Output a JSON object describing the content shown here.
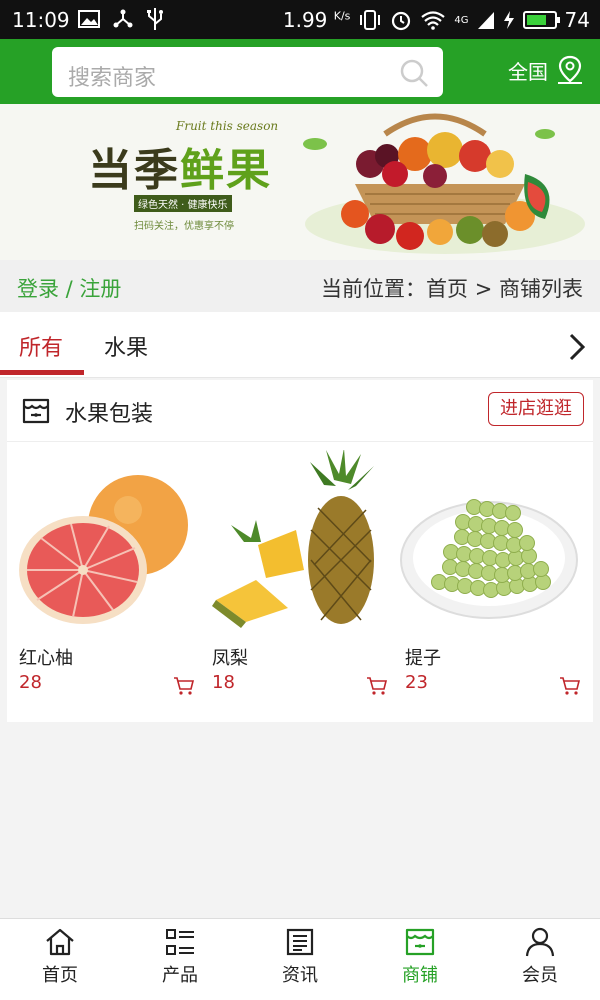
{
  "status_bar": {
    "time": "11:09",
    "speed": "1.99",
    "speed_unit": "K/s",
    "network": "4G",
    "battery_percent": "74",
    "battery_level": 0.74
  },
  "header": {
    "search_placeholder": "搜索商家",
    "region_label": "全国"
  },
  "banner": {
    "title_part1": "当季",
    "title_part2": "鲜果",
    "subtitle_en": "Fruit this season",
    "tagline": "绿色天然 · 健康快乐",
    "note": "扫码关注，优惠享不停"
  },
  "location_bar": {
    "login_register": "登录 / 注册",
    "current_position": "当前位置：首页 > 商铺列表"
  },
  "tabs": [
    {
      "label": "所有",
      "active": true
    },
    {
      "label": "水果",
      "active": false
    }
  ],
  "shop": {
    "name": "水果包装",
    "enter_label": "进店逛逛",
    "products": [
      {
        "name": "红心柚",
        "price": "28"
      },
      {
        "name": "凤梨",
        "price": "18"
      },
      {
        "name": "提子",
        "price": "23"
      }
    ]
  },
  "bottom_nav": [
    {
      "label": "首页",
      "icon": "home-icon",
      "active": false
    },
    {
      "label": "产品",
      "icon": "list-icon",
      "active": false
    },
    {
      "label": "资讯",
      "icon": "news-icon",
      "active": false
    },
    {
      "label": "商铺",
      "icon": "shop-icon",
      "active": true
    },
    {
      "label": "会员",
      "icon": "user-icon",
      "active": false
    }
  ],
  "colors": {
    "brand_green": "#26a126",
    "accent_red": "#c0262b"
  }
}
